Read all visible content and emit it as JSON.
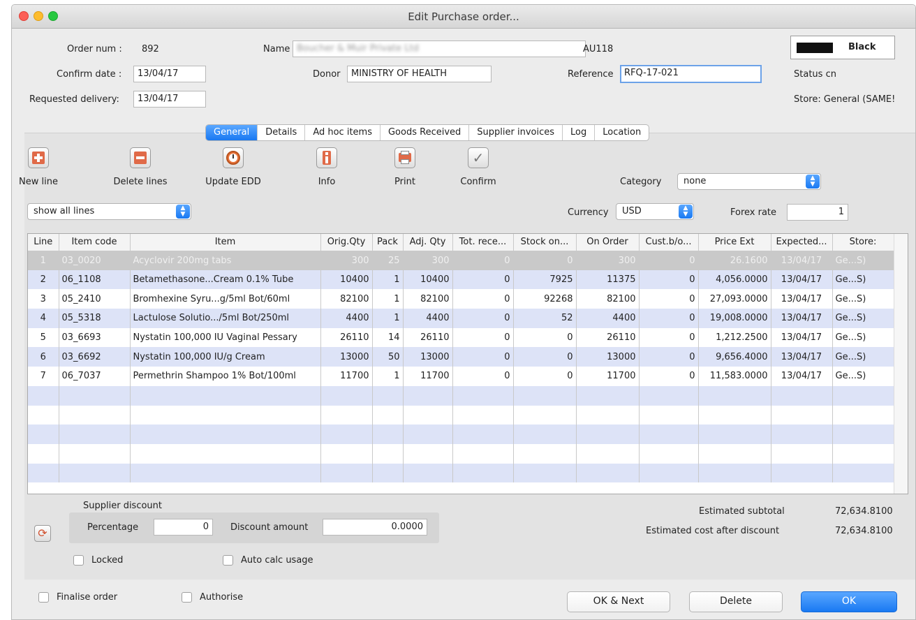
{
  "window": {
    "title": "Edit Purchase order..."
  },
  "header": {
    "order_num_label": "Order num :",
    "order_num": "892",
    "name_label": "Name",
    "name_value": "Boucher & Muir Private Ltd",
    "supplier_code": "AU118",
    "confirm_date_label": "Confirm date :",
    "confirm_date": "13/04/17",
    "donor_label": "Donor",
    "donor": "MINISTRY OF HEALTH",
    "reference_label": "Reference",
    "reference": "RFQ-17-021",
    "requested_delivery_label": "Requested delivery:",
    "requested_delivery": "13/04/17",
    "color_label": "Black",
    "color_value": "#111111",
    "status_label": "Status",
    "status": "cn",
    "store_label": "Store:",
    "store": "General (SAME!"
  },
  "tabs": [
    {
      "label": "General",
      "active": true
    },
    {
      "label": "Details"
    },
    {
      "label": "Ad hoc items"
    },
    {
      "label": "Goods Received"
    },
    {
      "label": "Supplier invoices"
    },
    {
      "label": "Log"
    },
    {
      "label": "Location"
    }
  ],
  "toolbar": {
    "new_line": "New line",
    "delete_lines": "Delete lines",
    "update_edd": "Update EDD",
    "info": "Info",
    "print": "Print",
    "confirm": "Confirm"
  },
  "filters": {
    "show_lines": "show all lines",
    "category_label": "Category",
    "category": "none",
    "currency_label": "Currency",
    "currency": "USD",
    "forex_label": "Forex rate",
    "forex": "1"
  },
  "table": {
    "columns": [
      "Line",
      "Item code",
      "Item",
      "Orig.Qty",
      "Pack",
      "Adj. Qty",
      "Tot. rece...",
      "Stock on...",
      "On Order",
      "Cust.b/o...",
      "Price Ext",
      "Expected...",
      "Store:"
    ],
    "rows": [
      [
        "1",
        "03_0020",
        "Acyclovir 200mg tabs",
        "300",
        "25",
        "300",
        "0",
        "0",
        "300",
        "0",
        "26.1600",
        "13/04/17",
        "Ge...S)"
      ],
      [
        "2",
        "06_1108",
        "Betamethasone...Cream 0.1% Tube",
        "10400",
        "1",
        "10400",
        "0",
        "7925",
        "11375",
        "0",
        "4,056.0000",
        "13/04/17",
        "Ge...S)"
      ],
      [
        "3",
        "05_2410",
        "Bromhexine Syru...g/5ml Bot/60ml",
        "82100",
        "1",
        "82100",
        "0",
        "92268",
        "82100",
        "0",
        "27,093.0000",
        "13/04/17",
        "Ge...S)"
      ],
      [
        "4",
        "05_5318",
        "Lactulose Solutio.../5ml Bot/250ml",
        "4400",
        "1",
        "4400",
        "0",
        "52",
        "4400",
        "0",
        "19,008.0000",
        "13/04/17",
        "Ge...S)"
      ],
      [
        "5",
        "03_6693",
        "Nystatin 100,000 IU Vaginal Pessary",
        "26110",
        "14",
        "26110",
        "0",
        "0",
        "26110",
        "0",
        "1,212.2500",
        "13/04/17",
        "Ge...S)"
      ],
      [
        "6",
        "03_6692",
        "Nystatin 100,000 IU/g Cream",
        "13000",
        "50",
        "13000",
        "0",
        "0",
        "13000",
        "0",
        "9,656.4000",
        "13/04/17",
        "Ge...S)"
      ],
      [
        "7",
        "06_7037",
        "Permethrin Shampoo 1% Bot/100ml",
        "11700",
        "1",
        "11700",
        "0",
        "0",
        "11700",
        "0",
        "11,583.0000",
        "13/04/17",
        "Ge...S)"
      ]
    ]
  },
  "discount": {
    "title": "Supplier discount",
    "percentage_label": "Percentage",
    "percentage": "0",
    "amount_label": "Discount amount",
    "amount": "0.0000"
  },
  "totals": {
    "subtotal_label": "Estimated subtotal",
    "subtotal": "72,634.8100",
    "after_discount_label": "Estimated cost after discount",
    "after_discount": "72,634.8100"
  },
  "options": {
    "locked": "Locked",
    "auto_calc": "Auto calc usage",
    "finalise": "Finalise order",
    "authorise": "Authorise"
  },
  "buttons": {
    "ok_next": "OK & Next",
    "delete": "Delete",
    "ok": "OK"
  }
}
